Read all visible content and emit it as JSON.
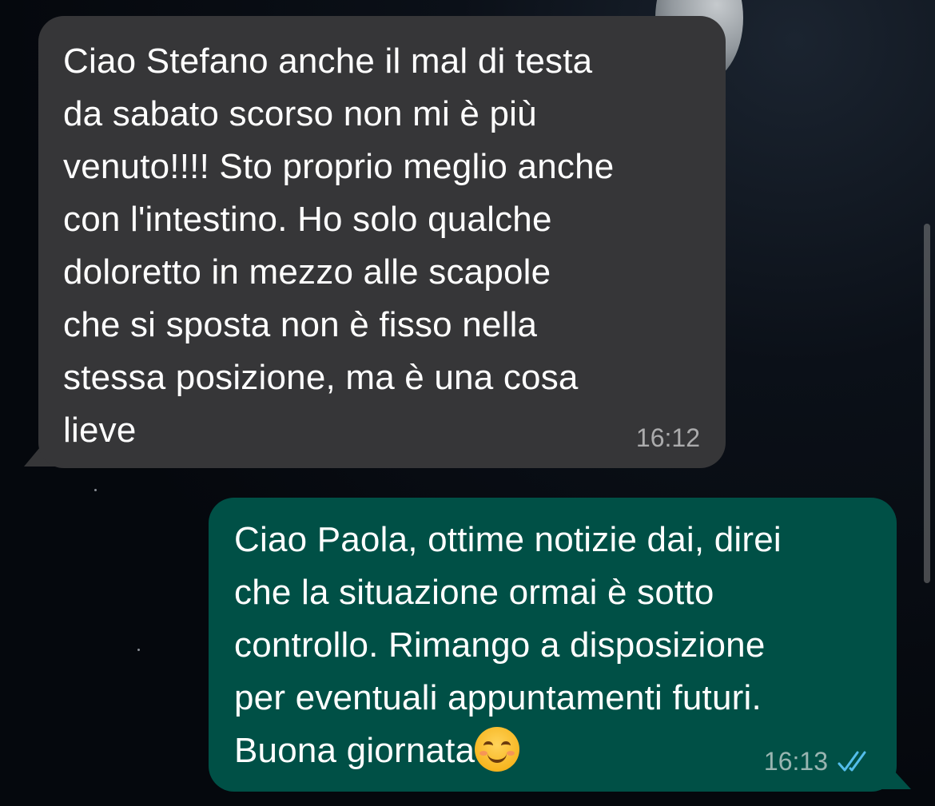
{
  "chat": {
    "messages": [
      {
        "direction": "incoming",
        "text": "Ciao Stefano anche il mal di testa\nda sabato scorso non mi è più\nvenuto!!!! Sto proprio meglio anche\ncon l'intestino.  Ho solo qualche\ndoloretto in mezzo alle scapole\nche si sposta non è fisso nella\nstessa posizione, ma è una cosa\nlieve",
        "time": "16:12"
      },
      {
        "direction": "outgoing",
        "text": "Ciao Paola, ottime notizie dai, direi\nche la situazione ormai è sotto\ncontrollo. Rimango a disposizione\nper eventuali appuntamenti futuri.\nBuona giornata",
        "emoji": "smiling-face-with-smiling-eyes",
        "time": "16:13",
        "status": "read",
        "status_icon": "double-check-icon"
      }
    ]
  },
  "colors": {
    "incoming_bubble": "#363638",
    "outgoing_bubble": "#005046",
    "read_ticks": "#53bdeb",
    "background": "#05080d"
  }
}
